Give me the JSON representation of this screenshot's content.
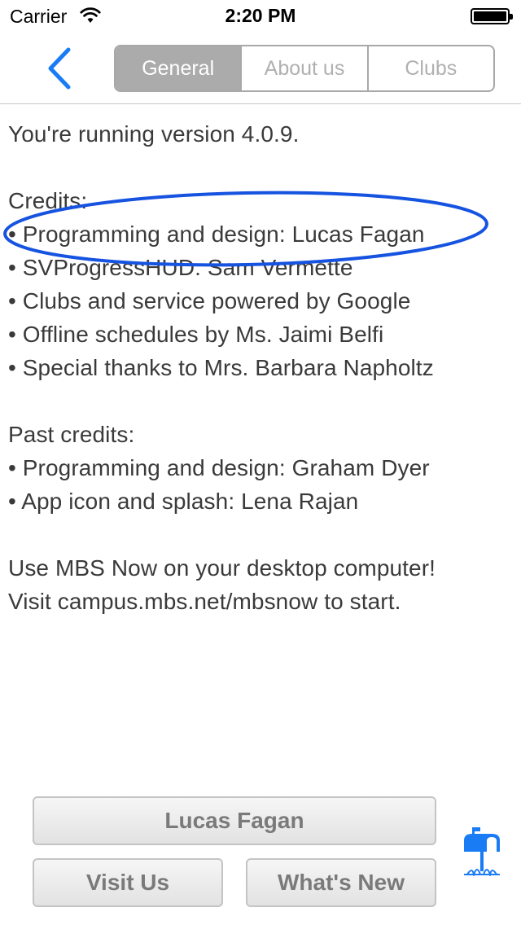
{
  "status_bar": {
    "carrier": "Carrier",
    "time": "2:20 PM",
    "wifi_icon": "wifi-icon",
    "battery_icon": "battery-full-icon"
  },
  "nav": {
    "back_icon": "chevron-left-icon",
    "accent_color": "#1a7cf5",
    "segments": [
      {
        "label": "General",
        "selected": true
      },
      {
        "label": "About us",
        "selected": false
      },
      {
        "label": "Clubs",
        "selected": false
      }
    ]
  },
  "content": {
    "version_text": "You're running version 4.0.9.",
    "credits_heading": "Credits:",
    "credits": [
      "• Programming and design: Lucas Fagan",
      "• SVProgressHUD: Sam Vermette",
      "• Clubs and service powered by Google",
      "• Offline schedules by Ms. Jaimi Belfi",
      "• Special thanks to Mrs. Barbara Napholtz"
    ],
    "past_credits_heading": "Past credits:",
    "past_credits": [
      "• Programming and design: Graham Dyer",
      "• App icon and splash: Lena Rajan"
    ],
    "desktop_line_1": "Use MBS Now on your desktop computer!",
    "desktop_line_2": "Visit campus.mbs.net/mbsnow to start."
  },
  "annotation": {
    "shape": "ellipse",
    "color": "#1553e0",
    "highlights": "content.credits.0"
  },
  "buttons": {
    "author": "Lucas Fagan",
    "visit_us": "Visit Us",
    "whats_new": "What's New",
    "mailbox_icon": "mailbox-icon"
  }
}
